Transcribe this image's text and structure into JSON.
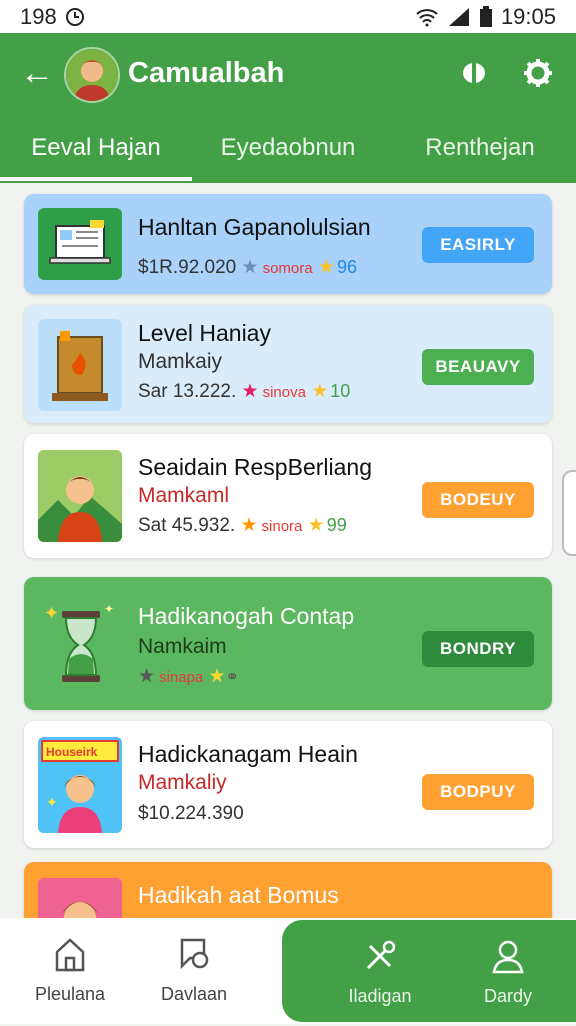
{
  "status": {
    "left_text": "198",
    "time": "19:05"
  },
  "appbar": {
    "title": "Camualbah"
  },
  "tabs": [
    {
      "label": "Eeval Hajan",
      "active": true
    },
    {
      "label": "Eyedaobnun",
      "active": false
    },
    {
      "label": "Renthejan",
      "active": false
    }
  ],
  "cards": [
    {
      "title": "Hanltan Gapanolulsian",
      "meta_value": "$1R.92.020",
      "meta_tag": "somora",
      "meta_num": "96",
      "button": "EASIRLY"
    },
    {
      "title": "Level Haniay",
      "subtitle": "Mamkaiy",
      "meta_value": "Sar 13.222.",
      "meta_tag": "sinova",
      "meta_num": "10",
      "button": "BEAUAVY"
    },
    {
      "title": "Seaidain RespBerliang",
      "subtitle": "Mamkaml",
      "meta_value": "Sat 45.932.",
      "meta_tag": "sinora",
      "meta_num": "99",
      "button": "BODEUY"
    },
    {
      "title": "Hadikanogah Contap",
      "subtitle": "Namkaim",
      "meta_tag": "sinapa",
      "button": "BONDRY"
    },
    {
      "title": "Hadickanagam Heain",
      "subtitle": "Mamkaliy",
      "meta_value": "$10.224.390",
      "thumb_text": "Houseirk",
      "button": "BODPUY"
    },
    {
      "title": "Hadikah aat Bomus"
    }
  ],
  "bottom_nav": [
    {
      "label": "Pleulana",
      "icon": "home-icon"
    },
    {
      "label": "Davlaan",
      "icon": "feedback-icon"
    },
    {
      "label": "Iladigan",
      "icon": "tools-icon"
    },
    {
      "label": "Dardy",
      "icon": "profile-icon"
    }
  ],
  "colors": {
    "primary": "#43a047",
    "orange": "#ffa033",
    "blue_card": "#a7d0f8"
  }
}
